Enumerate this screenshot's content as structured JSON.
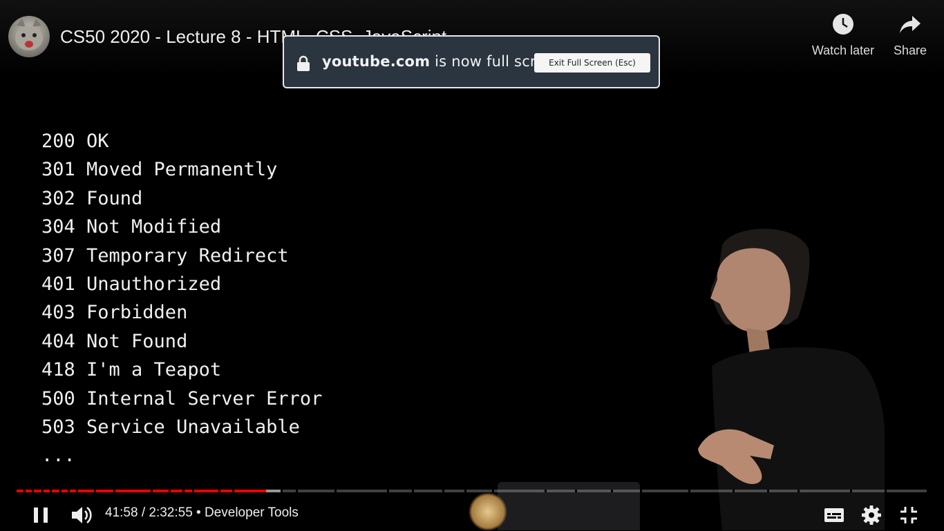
{
  "video": {
    "title": "CS50 2020 - Lecture 8 - HTML, CSS, JavaScript"
  },
  "top_actions": {
    "watch_later_label": "Watch later",
    "share_label": "Share"
  },
  "fullscreen_notice": {
    "domain": "youtube.com",
    "message": " is now full screen",
    "exit_label": "Exit Full Screen (Esc)"
  },
  "slide": {
    "lines": [
      "200 OK",
      "301 Moved Permanently",
      "302 Found",
      "304 Not Modified",
      "307 Temporary Redirect",
      "401 Unauthorized",
      "403 Forbidden",
      "404 Not Found",
      "418 I'm a Teapot",
      "500 Internal Server Error",
      "503 Service Unavailable",
      "..."
    ]
  },
  "player": {
    "time_display": "41:58 / 2:32:55 • Developer Tools",
    "played_fraction": 0.2744,
    "loaded_fraction": 0.2897,
    "accent_color": "#ee0000"
  },
  "icons": {
    "pause": "pause-icon",
    "volume": "volume-icon",
    "captions": "captions-icon",
    "settings": "gear-icon",
    "exit_fullscreen": "exit-fullscreen-icon",
    "watch_later": "clock-icon",
    "share": "share-arrow-icon",
    "lock": "lock-icon"
  }
}
